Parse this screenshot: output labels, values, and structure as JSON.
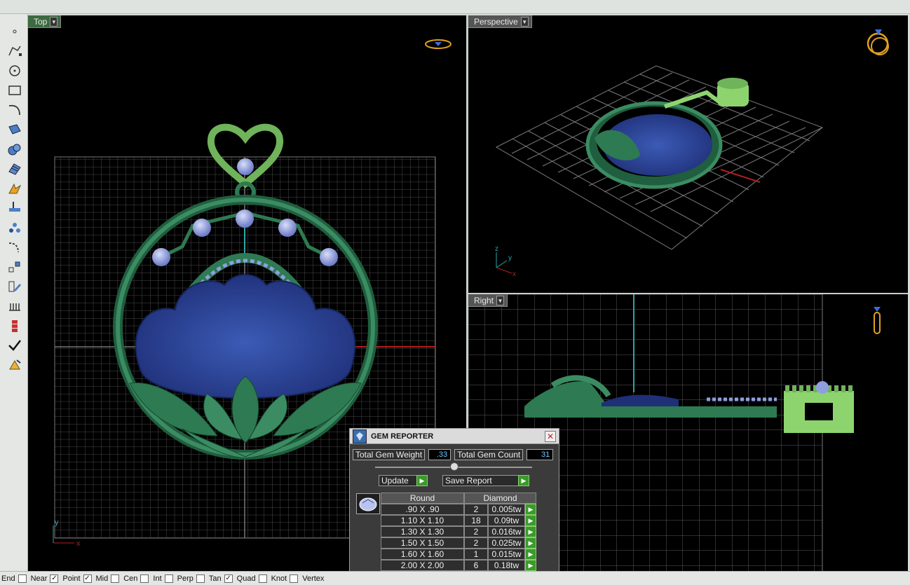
{
  "viewports": {
    "top": {
      "title": "Top",
      "axis_x": "x",
      "axis_y": "y"
    },
    "perspective": {
      "title": "Perspective",
      "axis_x": "x",
      "axis_y": "y",
      "axis_z": "z"
    },
    "right": {
      "title": "Right"
    }
  },
  "toolbar": {
    "icons": [
      "point-icon",
      "polyline-icon",
      "circle-icon",
      "rectangle-icon",
      "curve-icon",
      "surface-icon",
      "solid-icon",
      "mesh-icon",
      "transform-icon",
      "dimension-icon",
      "group-icon",
      "fillet-icon",
      "array-icon",
      "edit-icon",
      "gem-tools-icon",
      "stack-icon",
      "check-icon",
      "render-icon"
    ]
  },
  "gem_reporter": {
    "title": "GEM REPORTER",
    "total_weight_label": "Total Gem Weight",
    "total_weight_value": ".33",
    "total_count_label": "Total Gem Count",
    "total_count_value": "31",
    "update_label": "Update",
    "save_label": "Save Report",
    "col_shape": "Round",
    "col_material": "Diamond",
    "rows": [
      {
        "size": ".90 X .90",
        "count": "2",
        "weight": "0.005tw"
      },
      {
        "size": "1.10 X 1.10",
        "count": "18",
        "weight": "0.09tw"
      },
      {
        "size": "1.30 X 1.30",
        "count": "2",
        "weight": "0.016tw"
      },
      {
        "size": "1.50 X 1.50",
        "count": "2",
        "weight": "0.025tw"
      },
      {
        "size": "1.60 X 1.60",
        "count": "1",
        "weight": "0.015tw"
      },
      {
        "size": "2.00 X 2.00",
        "count": "6",
        "weight": "0.18tw"
      }
    ]
  },
  "osnap": [
    {
      "label": "End",
      "checked": false
    },
    {
      "label": "Near",
      "checked": false
    },
    {
      "label": "Point",
      "checked": true
    },
    {
      "label": "Mid",
      "checked": true
    },
    {
      "label": "Cen",
      "checked": false
    },
    {
      "label": "Int",
      "checked": false
    },
    {
      "label": "Perp",
      "checked": false
    },
    {
      "label": "Tan",
      "checked": false
    },
    {
      "label": "Quad",
      "checked": true
    },
    {
      "label": "Knot",
      "checked": false
    },
    {
      "label": "Vertex",
      "checked": false
    }
  ],
  "colors": {
    "metal": "#2e7a52",
    "gem_blue": "#2a3f8f",
    "stone": "#8f9ee0",
    "grid": "#5b5b5b",
    "axis_red": "#b41e1e",
    "axis_cyan": "#2aa6a6",
    "highlight_green": "#8ed46e"
  }
}
